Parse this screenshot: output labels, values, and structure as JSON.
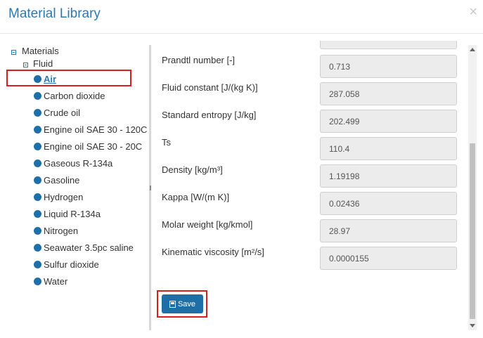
{
  "dialog": {
    "title": "Material Library",
    "close_symbol": "×"
  },
  "tree": {
    "root_label": "Materials",
    "group_label": "Fluid",
    "items": [
      {
        "label": "Air",
        "selected": true
      },
      {
        "label": "Carbon dioxide"
      },
      {
        "label": "Crude oil"
      },
      {
        "label": "Engine oil SAE 30 - 120C"
      },
      {
        "label": "Engine oil SAE 30 - 20C"
      },
      {
        "label": "Gaseous R-134a"
      },
      {
        "label": "Gasoline"
      },
      {
        "label": "Hydrogen"
      },
      {
        "label": "Liquid R-134a"
      },
      {
        "label": "Nitrogen"
      },
      {
        "label": "Seawater 3.5pc saline"
      },
      {
        "label": "Sulfur dioxide"
      },
      {
        "label": "Water"
      }
    ]
  },
  "properties": [
    {
      "label": "Prandtl number [-]",
      "value": "0.713"
    },
    {
      "label": "Fluid constant [J/(kg K)]",
      "value": "287.058"
    },
    {
      "label": "Standard entropy [J/kg]",
      "value": "202.499"
    },
    {
      "label": "Ts",
      "value": "110.4"
    },
    {
      "label": "Density [kg/m³]",
      "value": "1.19198"
    },
    {
      "label": "Kappa [W/(m K)]",
      "value": "0.02436"
    },
    {
      "label": "Molar weight [kg/kmol]",
      "value": "28.97"
    },
    {
      "label": "Kinematic viscosity [m²/s]",
      "value": "0.0000155"
    }
  ],
  "actions": {
    "save_label": "Save"
  },
  "colors": {
    "accent": "#1e6fa8",
    "title": "#2a7ab0",
    "highlight": "#d62020"
  }
}
